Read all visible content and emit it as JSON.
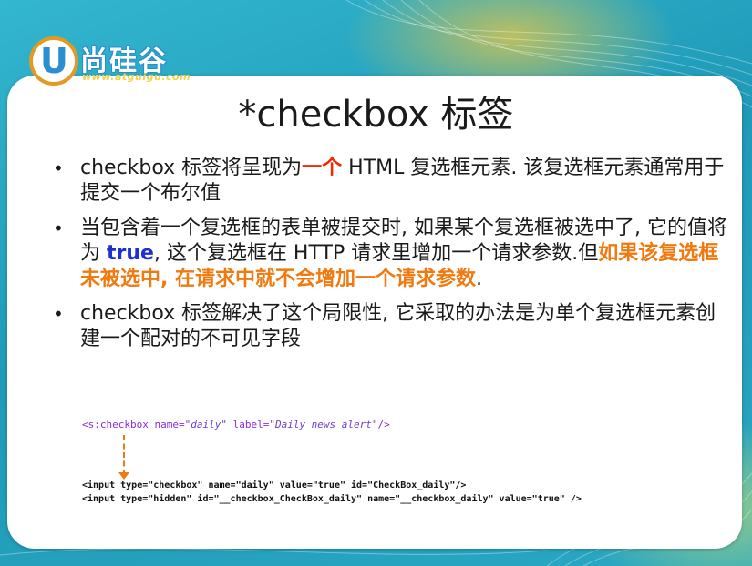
{
  "logo": {
    "letter": "U",
    "brand": "尚硅谷",
    "url": "www.atguigu.com"
  },
  "title": "*checkbox 标签",
  "bullets": [
    {
      "parts": [
        {
          "text": "checkbox 标签将呈现为",
          "style": "normal"
        },
        {
          "text": "一个",
          "style": "red"
        },
        {
          "text": " HTML 复选框元素. 该复选框元素通常用于提交一个布尔值",
          "style": "normal"
        }
      ]
    },
    {
      "parts": [
        {
          "text": "当包含着一个复选框的表单被提交时, 如果某个复选框被选中了, 它的值将为 ",
          "style": "normal"
        },
        {
          "text": "true",
          "style": "blue"
        },
        {
          "text": ", 这个复选框在 HTTP 请求里增加一个请求参数.但",
          "style": "normal"
        },
        {
          "text": "如果该复选框未被选中, 在请求中就不会增加一个请求参数",
          "style": "orange"
        },
        {
          "text": ".",
          "style": "normal"
        }
      ]
    },
    {
      "parts": [
        {
          "text": "checkbox 标签解决了这个局限性, 它采取的办法是为单个复选框元素创建一个配对的不可见字段",
          "style": "normal"
        }
      ]
    }
  ],
  "code_source": {
    "tag_open": "<s:checkbox ",
    "attr1": "name=",
    "val1": "\"daily\"",
    "attr2": " label=",
    "val2": "\"Daily news alert\"",
    "tag_close": "/>"
  },
  "code_output": {
    "line1": "<input type=\"checkbox\" name=\"daily\" value=\"true\" id=\"CheckBox_daily\"/>",
    "line2": "<input type=\"hidden\" id=\"__checkbox_CheckBox_daily\" name=\"__checkbox_daily\" value=\"true\" />"
  },
  "colors": {
    "accent_red": "#ee2b00",
    "accent_orange": "#f07a10",
    "accent_blue": "#1f2fd6",
    "background": "#2aa8c4"
  }
}
